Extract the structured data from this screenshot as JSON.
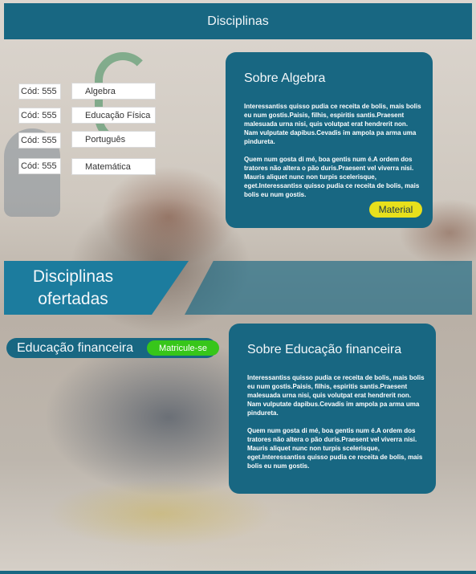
{
  "header": {
    "title": "Disciplinas"
  },
  "subjects": [
    {
      "code": "Cód: 555",
      "name": "Algebra"
    },
    {
      "code": "Cód: 555",
      "name": "Educação Física"
    },
    {
      "code": "Cód: 555",
      "name": "Português"
    },
    {
      "code": "Cód: 555",
      "name": "Matemática"
    }
  ],
  "about_card": {
    "title": "Sobre Algebra",
    "p1": "Interessantiss quisso pudia ce receita de bolis, mais bolis eu num gostis.Paisis, filhis, espiritis santis.Praesent malesuada urna nisi, quis volutpat erat hendrerit non. Nam vulputate dapibus.Cevadis im ampola pa arma uma pindureta.",
    "p2": "Quem num gosta di mé, boa gentis num é.A ordem dos tratores não altera o pão duris.Praesent vel viverra nisi. Mauris aliquet nunc non turpis scelerisque, eget.Interessantiss quisso pudia ce receita de bolis, mais bolis eu num gostis.",
    "button": "Material"
  },
  "banner": {
    "line1": "Disciplinas",
    "line2": "ofertadas"
  },
  "offered": {
    "name": "Educação financeira",
    "button": "Matricule-se"
  },
  "offered_card": {
    "title": "Sobre Educação financeira",
    "p1": "Interessantiss quisso pudia ce receita de bolis, mais bolis eu num gostis.Paisis, filhis, espiritis santis.Praesent malesuada urna nisi, quis volutpat erat hendrerit non. Nam vulputate dapibus.Cevadis im ampola pa arma uma pindureta.",
    "p2": "Quem num gosta di mé, boa gentis num é.A ordem dos tratores não altera o pão duris.Praesent vel viverra nisi. Mauris aliquet nunc non turpis scelerisque, eget.Interessantiss quisso pudia ce receita de bolis, mais bolis eu num gostis."
  },
  "colors": {
    "primary": "#186782",
    "accent_yellow": "#e8e01c",
    "accent_green": "#37c61a"
  }
}
